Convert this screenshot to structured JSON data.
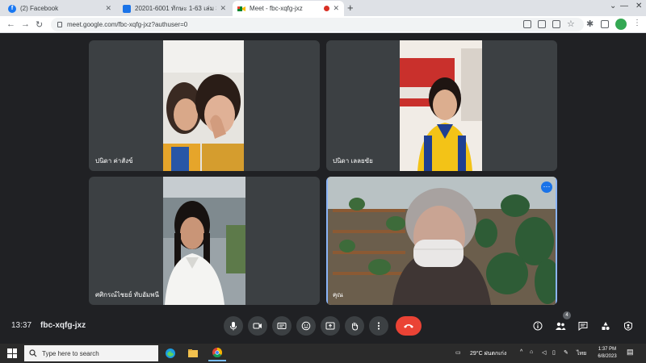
{
  "browser": {
    "tabs": [
      {
        "title": "(2) Facebook",
        "favicon": "facebook-icon"
      },
      {
        "title": "20201-6001 ทักษะ 1-63 เล่ม 3 ก",
        "favicon": "classroom-icon"
      },
      {
        "title": "Meet - fbc-xqfg-jxz",
        "favicon": "meet-icon",
        "recording": true
      }
    ],
    "url": "meet.google.com/fbc-xqfg-jxz?authuser=0"
  },
  "meet": {
    "participants": [
      {
        "name": "ปนิดา ค่าสังข์"
      },
      {
        "name": "ปนิดา เลลยขัย"
      },
      {
        "name": "ศศิกรณ์ไชยย์ ทับอัมพนี"
      },
      {
        "name": "คุณ"
      }
    ],
    "time": "13:37",
    "meeting_code": "fbc-xqfg-jxz",
    "participant_count": "4",
    "controls": [
      "microphone-icon",
      "camera-icon",
      "captions-icon",
      "emoji-icon",
      "present-icon",
      "raise-hand-icon",
      "more-options-icon",
      "end-call-icon"
    ],
    "right_controls": [
      "info-icon",
      "people-icon",
      "chat-icon",
      "activities-icon",
      "host-controls-icon"
    ]
  },
  "taskbar": {
    "search_placeholder": "Type here to search",
    "weather": "29°C ฝนตกเก่ง",
    "language": "ไทย",
    "time": "1:37 PM",
    "date": "6/8/2023"
  },
  "colors": {
    "speaking_outline": "#8ab4f8",
    "end_call": "#ea4335",
    "meet_bg": "#202124",
    "tile_bg": "#3c4043"
  }
}
